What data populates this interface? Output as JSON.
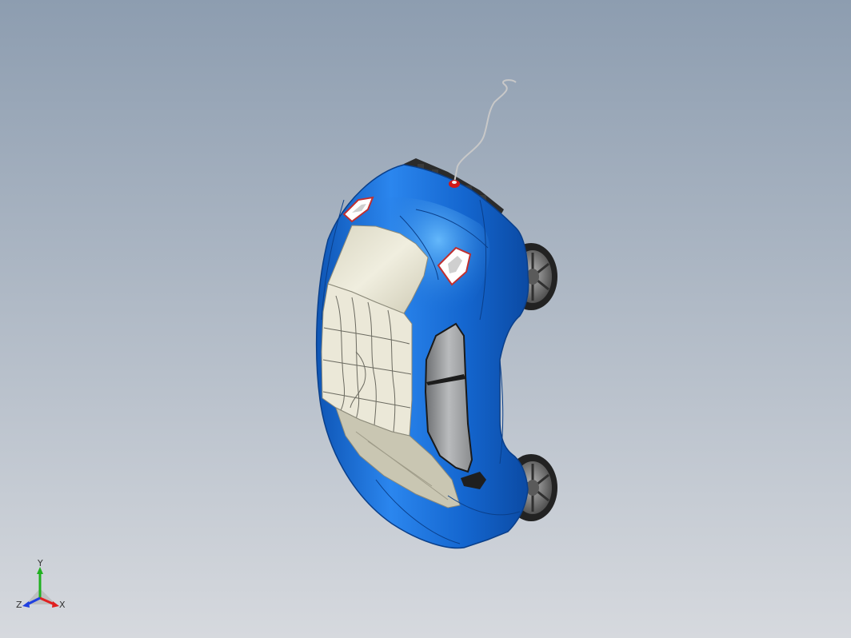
{
  "viewport": {
    "background_top": "#8d9db0",
    "background_bottom": "#d6d9de"
  },
  "model": {
    "body_color": "#1a6fd6",
    "body_highlight": "#5fb0ff",
    "glass_color": "#e6e3d2",
    "tire_color": "#2a2a2a",
    "rim_color": "#7c7c7c",
    "antenna_color": "#c8c8c8",
    "antenna_base_color": "#d01818"
  },
  "triad": {
    "x_label": "X",
    "y_label": "Y",
    "z_label": "Z",
    "x_color": "#e02020",
    "y_color": "#20b020",
    "z_color": "#2040e0"
  }
}
